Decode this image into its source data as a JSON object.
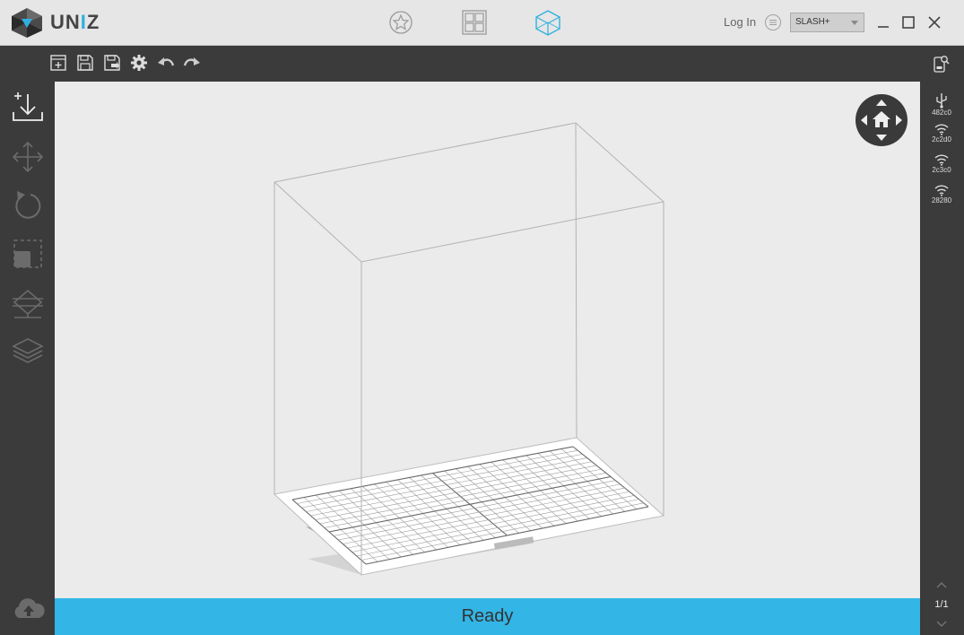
{
  "app": {
    "logo_text_main": "UN",
    "logo_text_accent": "I",
    "logo_text_tail": "Z"
  },
  "header": {
    "modes": [
      {
        "name": "favorites-mode",
        "icon": "star-circle-icon"
      },
      {
        "name": "grid-mode",
        "icon": "four-squares-icon"
      },
      {
        "name": "3d-view-mode",
        "icon": "cube-icon",
        "active": true
      }
    ],
    "login_label": "Log In",
    "printer_selected": "SLASH+"
  },
  "toolbar": {
    "icons": [
      "new-project-icon",
      "save-icon",
      "save-as-icon",
      "settings-gear-icon",
      "undo-icon",
      "redo-icon"
    ]
  },
  "left_tools": [
    "import-icon",
    "move-icon",
    "rotate-icon",
    "scale-icon",
    "support-icon",
    "slice-layers-icon"
  ],
  "right_panel": {
    "connections": [
      {
        "type": "usb",
        "icon": "usb-icon",
        "label": "482c0"
      },
      {
        "type": "wifi",
        "icon": "wifi-icon",
        "label": "2c2d0"
      },
      {
        "type": "wifi",
        "icon": "wifi-icon",
        "label": "2c3c0"
      },
      {
        "type": "wifi",
        "icon": "wifi-icon",
        "label": "28280"
      }
    ],
    "page": "1/1"
  },
  "status": {
    "text": "Ready"
  },
  "colors": {
    "accent": "#33b5e5",
    "chrome": "#3b3b3b",
    "titlebar": "#e6e6e6",
    "viewport": "#ebebeb"
  }
}
